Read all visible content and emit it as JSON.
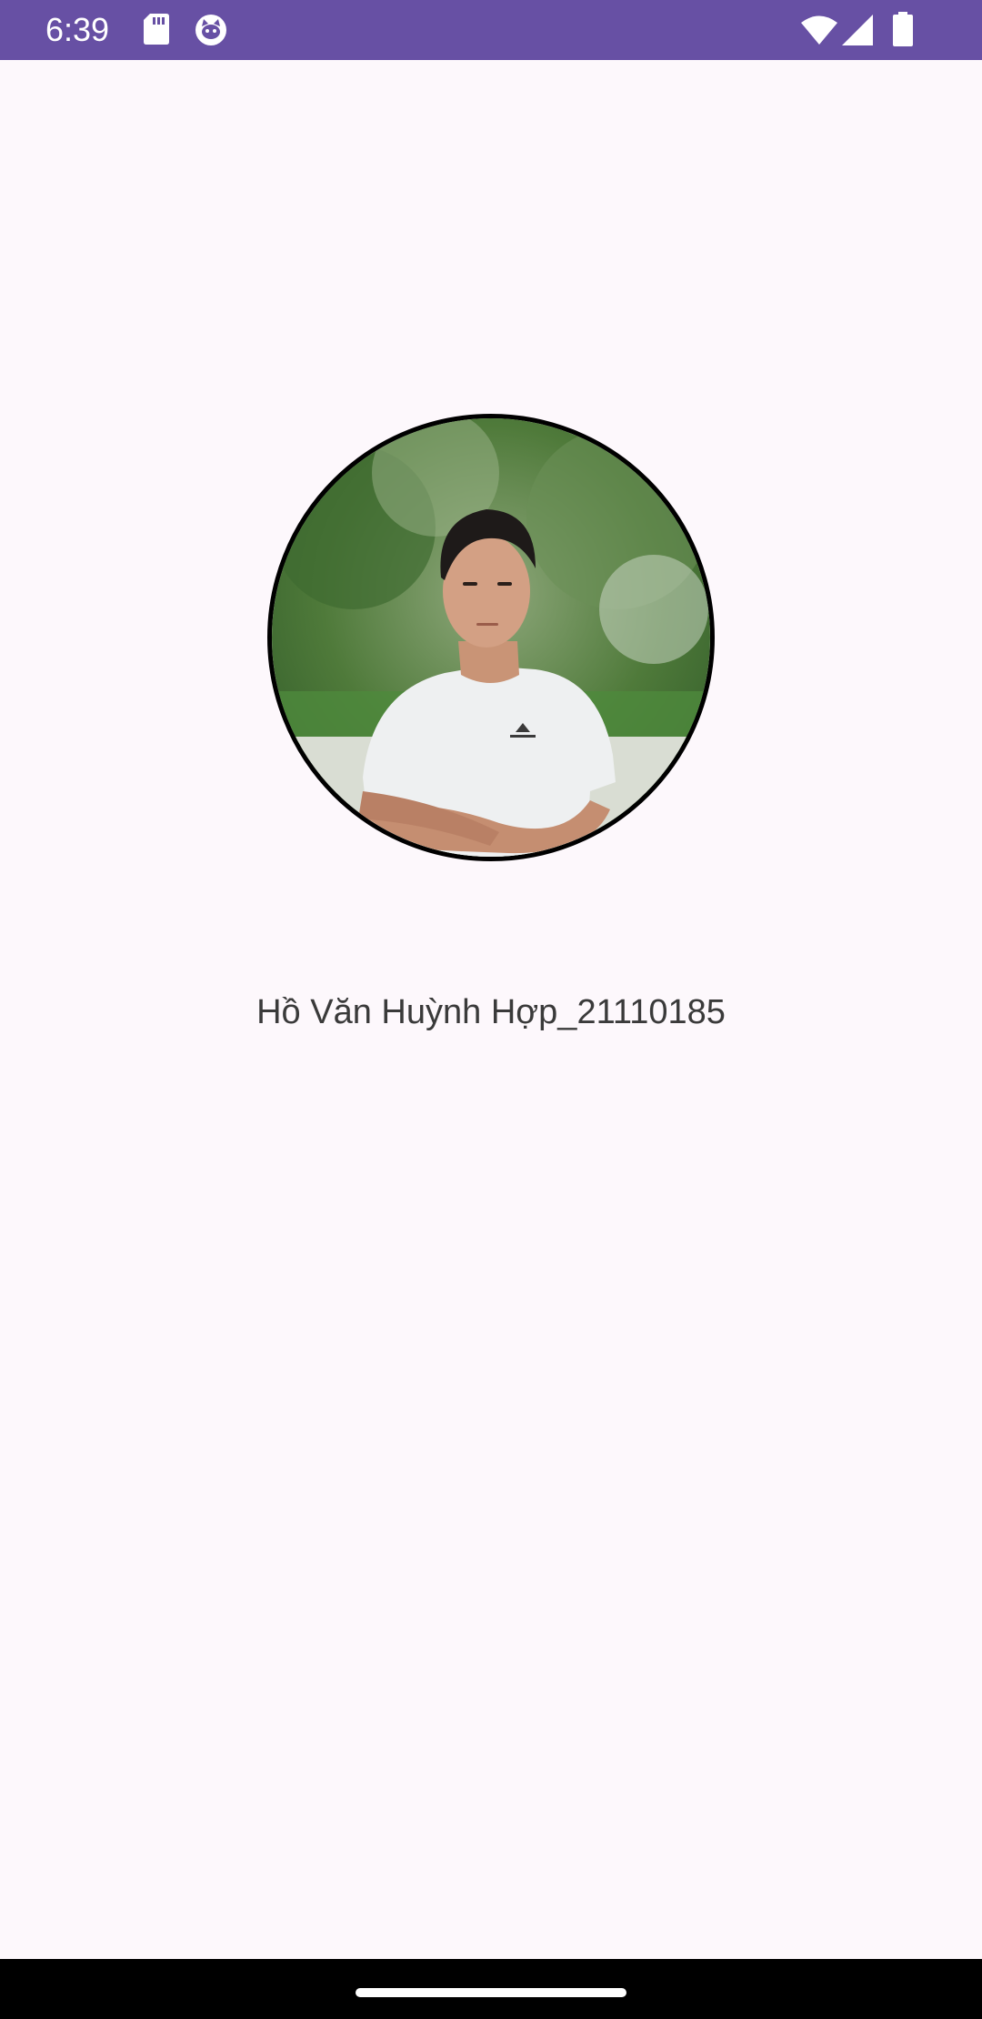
{
  "status_bar": {
    "time": "6:39",
    "background_color": "#6750a4",
    "left_icons": [
      "sd-card-icon",
      "cat-face-icon"
    ],
    "right_icons": [
      "wifi-icon",
      "cellular-signal-icon",
      "battery-icon"
    ]
  },
  "profile": {
    "name": "Hồ Văn Huỳnh Hợp_21110185",
    "avatar_border_color": "#000000"
  },
  "nav_bar": {
    "background_color": "#000000",
    "handle_color": "#ffffff"
  }
}
